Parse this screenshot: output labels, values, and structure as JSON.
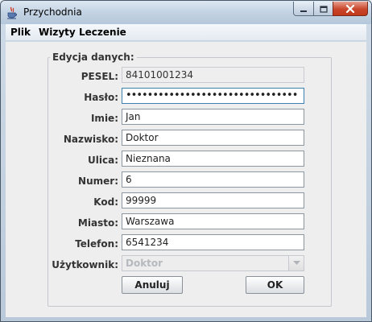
{
  "window": {
    "title": "Przychodnia"
  },
  "menu": {
    "items": [
      "Plik",
      "Wizyty",
      "Leczenie"
    ]
  },
  "form": {
    "group_title": "Edycja danych:",
    "rows": [
      {
        "label": "PESEL:",
        "value": "84101001234"
      },
      {
        "label": "Hasło:",
        "value": "••••••••••••••••••••••••••••••••"
      },
      {
        "label": "Imie:",
        "value": "Jan"
      },
      {
        "label": "Nazwisko:",
        "value": "Doktor"
      },
      {
        "label": "Ulica:",
        "value": "Nieznana"
      },
      {
        "label": "Numer:",
        "value": "6"
      },
      {
        "label": "Kod:",
        "value": "99999"
      },
      {
        "label": "Miasto:",
        "value": "Warszawa"
      },
      {
        "label": "Telefon:",
        "value": "6541234"
      }
    ],
    "user_label": "Użytkownik:",
    "user_value": "Doktor",
    "cancel_label": "Anuluj",
    "ok_label": "OK"
  },
  "icons": {
    "app": "java-cup-icon",
    "minimize": "minimize-icon",
    "maximize": "maximize-icon",
    "close": "close-icon",
    "dropdown": "chevron-down-icon"
  },
  "colors": {
    "titlebar": "#c3d3e4",
    "close_button": "#c9462c",
    "panel": "#eeeeee"
  }
}
